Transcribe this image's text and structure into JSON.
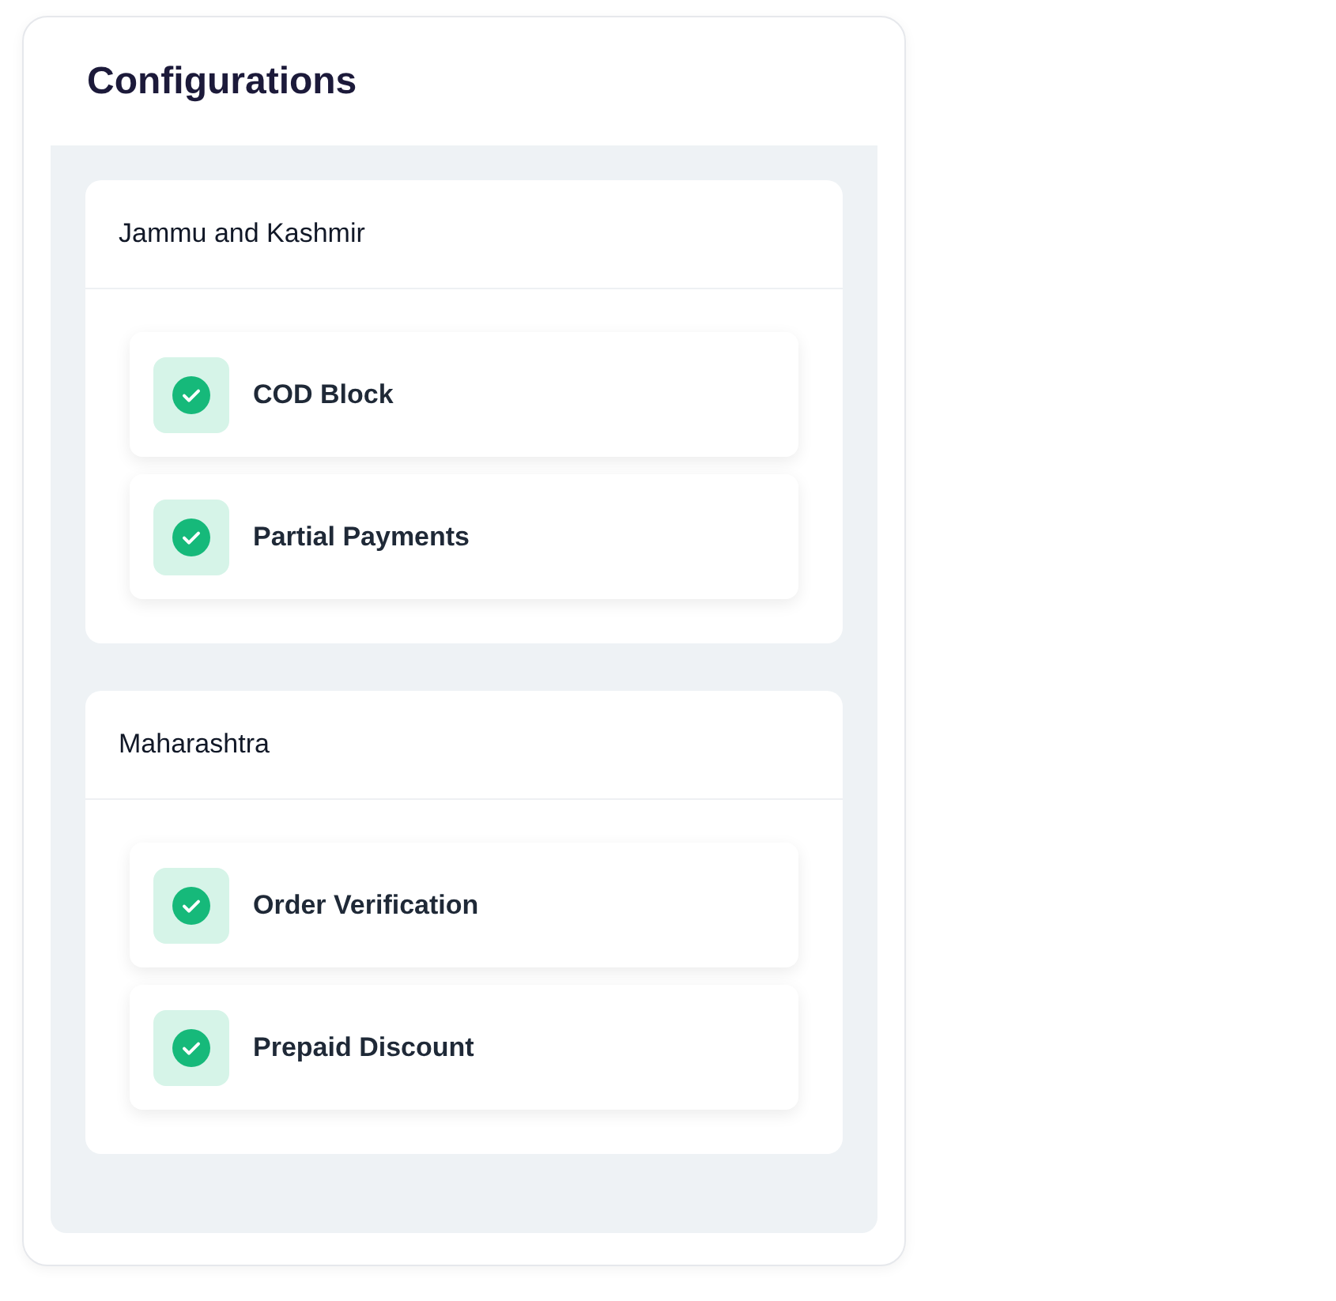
{
  "title": "Configurations",
  "sections": [
    {
      "name": "Jammu and Kashmir",
      "items": [
        {
          "label": "COD Block",
          "checked": true
        },
        {
          "label": "Partial Payments",
          "checked": true
        }
      ]
    },
    {
      "name": "Maharashtra",
      "items": [
        {
          "label": "Order Verification",
          "checked": true
        },
        {
          "label": "Prepaid Discount",
          "checked": true
        }
      ]
    }
  ]
}
